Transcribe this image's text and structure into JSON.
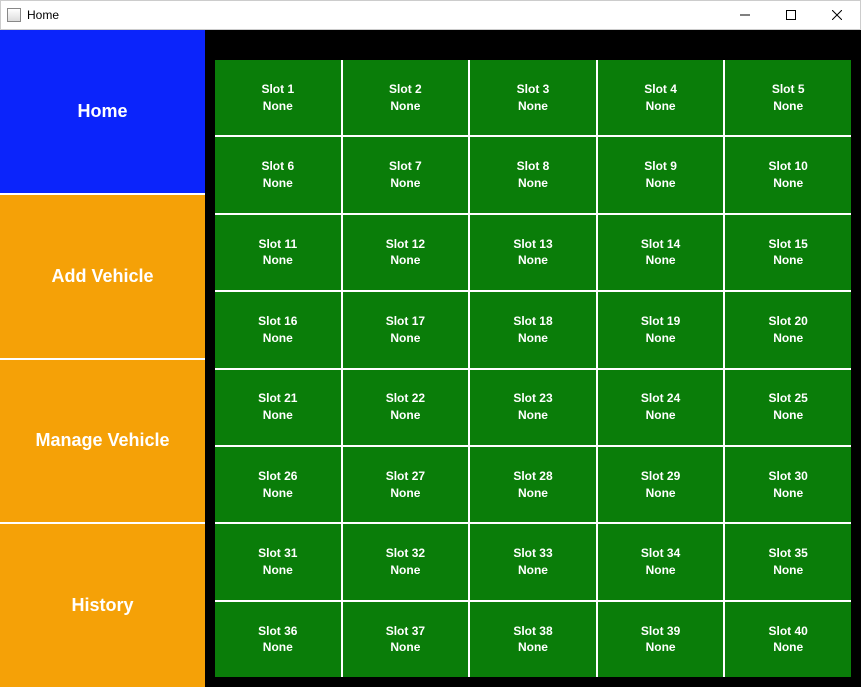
{
  "window": {
    "title": "Home"
  },
  "colors": {
    "nav_active": "#0b24fb",
    "nav_default": "#f5a107",
    "slot_bg": "#0a7d09"
  },
  "sidebar": {
    "items": [
      {
        "id": "home",
        "label": "Home",
        "active": true
      },
      {
        "id": "add-vehicle",
        "label": "Add Vehicle",
        "active": false
      },
      {
        "id": "manage-vehicle",
        "label": "Manage Vehicle",
        "active": false
      },
      {
        "id": "history",
        "label": "History",
        "active": false
      }
    ]
  },
  "slots": [
    {
      "name": "Slot 1",
      "status": "None"
    },
    {
      "name": "Slot 2",
      "status": "None"
    },
    {
      "name": "Slot 3",
      "status": "None"
    },
    {
      "name": "Slot 4",
      "status": "None"
    },
    {
      "name": "Slot 5",
      "status": "None"
    },
    {
      "name": "Slot 6",
      "status": "None"
    },
    {
      "name": "Slot 7",
      "status": "None"
    },
    {
      "name": "Slot 8",
      "status": "None"
    },
    {
      "name": "Slot 9",
      "status": "None"
    },
    {
      "name": "Slot 10",
      "status": "None"
    },
    {
      "name": "Slot 11",
      "status": "None"
    },
    {
      "name": "Slot 12",
      "status": "None"
    },
    {
      "name": "Slot 13",
      "status": "None"
    },
    {
      "name": "Slot 14",
      "status": "None"
    },
    {
      "name": "Slot 15",
      "status": "None"
    },
    {
      "name": "Slot 16",
      "status": "None"
    },
    {
      "name": "Slot 17",
      "status": "None"
    },
    {
      "name": "Slot 18",
      "status": "None"
    },
    {
      "name": "Slot 19",
      "status": "None"
    },
    {
      "name": "Slot 20",
      "status": "None"
    },
    {
      "name": "Slot 21",
      "status": "None"
    },
    {
      "name": "Slot 22",
      "status": "None"
    },
    {
      "name": "Slot 23",
      "status": "None"
    },
    {
      "name": "Slot 24",
      "status": "None"
    },
    {
      "name": "Slot 25",
      "status": "None"
    },
    {
      "name": "Slot 26",
      "status": "None"
    },
    {
      "name": "Slot 27",
      "status": "None"
    },
    {
      "name": "Slot 28",
      "status": "None"
    },
    {
      "name": "Slot 29",
      "status": "None"
    },
    {
      "name": "Slot 30",
      "status": "None"
    },
    {
      "name": "Slot 31",
      "status": "None"
    },
    {
      "name": "Slot 32",
      "status": "None"
    },
    {
      "name": "Slot 33",
      "status": "None"
    },
    {
      "name": "Slot 34",
      "status": "None"
    },
    {
      "name": "Slot 35",
      "status": "None"
    },
    {
      "name": "Slot 36",
      "status": "None"
    },
    {
      "name": "Slot 37",
      "status": "None"
    },
    {
      "name": "Slot 38",
      "status": "None"
    },
    {
      "name": "Slot 39",
      "status": "None"
    },
    {
      "name": "Slot 40",
      "status": "None"
    }
  ]
}
